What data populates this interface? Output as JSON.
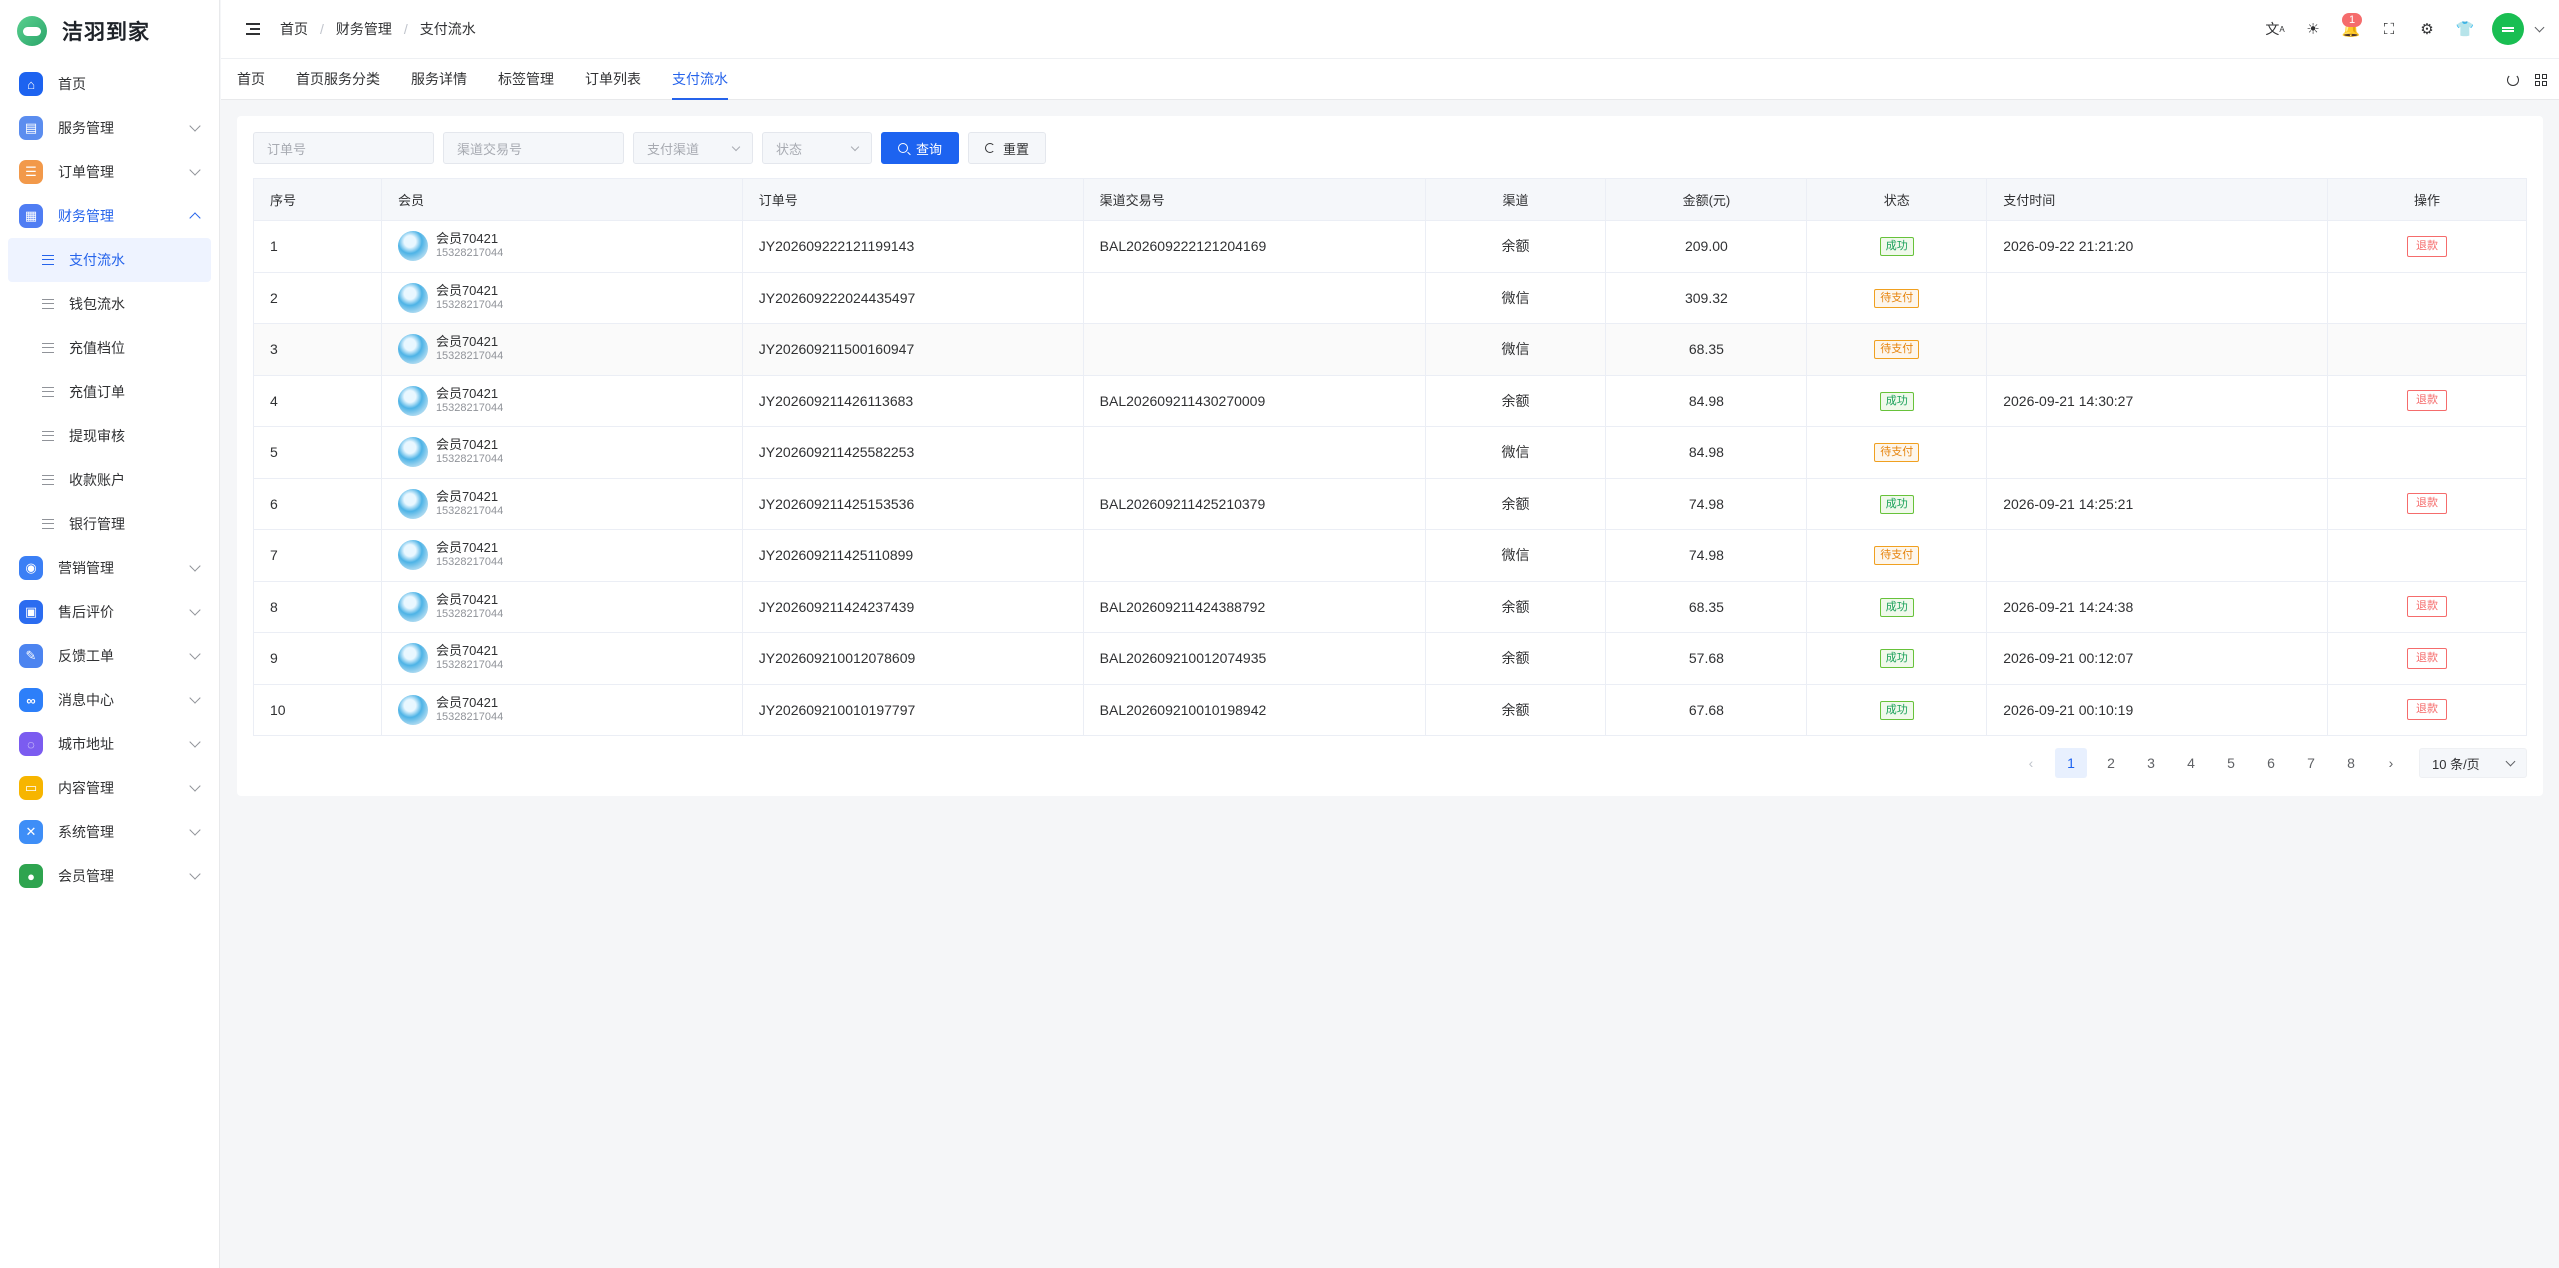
{
  "app": {
    "name": "洁羽到家"
  },
  "sidebar": {
    "items": [
      {
        "label": "首页",
        "icon": "home-icon",
        "color": "#1d63f0",
        "glyph": "⌂",
        "expandable": false
      },
      {
        "label": "服务管理",
        "icon": "clipboard-icon",
        "color": "#5b8def",
        "glyph": "▤",
        "expandable": true
      },
      {
        "label": "订单管理",
        "icon": "order-list-icon",
        "color": "#f2994a",
        "glyph": "☰",
        "expandable": true
      },
      {
        "label": "财务管理",
        "icon": "finance-icon",
        "color": "#4f7df3",
        "glyph": "▦",
        "expandable": true,
        "open": true
      }
    ],
    "finance_sub": [
      {
        "label": "支付流水",
        "active": true
      },
      {
        "label": "钱包流水"
      },
      {
        "label": "充值档位"
      },
      {
        "label": "充值订单"
      },
      {
        "label": "提现审核"
      },
      {
        "label": "收款账户"
      },
      {
        "label": "银行管理"
      }
    ],
    "items_after": [
      {
        "label": "营销管理",
        "icon": "marketing-icon",
        "color": "#3b7ff5",
        "glyph": "◉"
      },
      {
        "label": "售后评价",
        "icon": "apps-icon",
        "color": "#2b6cf0",
        "glyph": "▣"
      },
      {
        "label": "反馈工单",
        "icon": "feedback-icon",
        "color": "#4c84f0",
        "glyph": "✎"
      },
      {
        "label": "消息中心",
        "icon": "link-icon",
        "color": "#2d7ff9",
        "glyph": "∞"
      },
      {
        "label": "城市地址",
        "icon": "planet-icon",
        "color": "#7b5cf0",
        "glyph": "◌"
      },
      {
        "label": "内容管理",
        "icon": "folder-icon",
        "color": "#f7b500",
        "glyph": "▭"
      },
      {
        "label": "系统管理",
        "icon": "tools-icon",
        "color": "#3e8ef7",
        "glyph": "✕"
      },
      {
        "label": "会员管理",
        "icon": "user-icon",
        "color": "#2ea44f",
        "glyph": "●"
      }
    ]
  },
  "header": {
    "breadcrumb": [
      "首页",
      "财务管理",
      "支付流水"
    ],
    "notification_count": "1"
  },
  "tabs": [
    "首页",
    "首页服务分类",
    "服务详情",
    "标签管理",
    "订单列表",
    "支付流水"
  ],
  "active_tab": 5,
  "filters": {
    "order_no_placeholder": "订单号",
    "channel_txn_placeholder": "渠道交易号",
    "channel_placeholder": "支付渠道",
    "status_placeholder": "状态",
    "search_label": "查询",
    "reset_label": "重置"
  },
  "table": {
    "columns": [
      "序号",
      "会员",
      "订单号",
      "渠道交易号",
      "渠道",
      "金额(元)",
      "状态",
      "支付时间",
      "操作"
    ],
    "refund_label": "退款",
    "rows": [
      {
        "no": "1",
        "member": "会员70421",
        "phone": "15328217044",
        "order": "JY202609222121199143",
        "txn": "BAL202609222121204169",
        "channel": "余额",
        "amount": "209.00",
        "status": "成功",
        "status_type": "success",
        "time": "2026-09-22 21:21:20",
        "refund": true
      },
      {
        "no": "2",
        "member": "会员70421",
        "phone": "15328217044",
        "order": "JY202609222024435497",
        "txn": "",
        "channel": "微信",
        "amount": "309.32",
        "status": "待支付",
        "status_type": "warning",
        "time": "",
        "refund": false
      },
      {
        "no": "3",
        "member": "会员70421",
        "phone": "15328217044",
        "order": "JY202609211500160947",
        "txn": "",
        "channel": "微信",
        "amount": "68.35",
        "status": "待支付",
        "status_type": "warning",
        "time": "",
        "refund": false
      },
      {
        "no": "4",
        "member": "会员70421",
        "phone": "15328217044",
        "order": "JY202609211426113683",
        "txn": "BAL202609211430270009",
        "channel": "余额",
        "amount": "84.98",
        "status": "成功",
        "status_type": "success",
        "time": "2026-09-21 14:30:27",
        "refund": true
      },
      {
        "no": "5",
        "member": "会员70421",
        "phone": "15328217044",
        "order": "JY202609211425582253",
        "txn": "",
        "channel": "微信",
        "amount": "84.98",
        "status": "待支付",
        "status_type": "warning",
        "time": "",
        "refund": false
      },
      {
        "no": "6",
        "member": "会员70421",
        "phone": "15328217044",
        "order": "JY202609211425153536",
        "txn": "BAL202609211425210379",
        "channel": "余额",
        "amount": "74.98",
        "status": "成功",
        "status_type": "success",
        "time": "2026-09-21 14:25:21",
        "refund": true
      },
      {
        "no": "7",
        "member": "会员70421",
        "phone": "15328217044",
        "order": "JY202609211425110899",
        "txn": "",
        "channel": "微信",
        "amount": "74.98",
        "status": "待支付",
        "status_type": "warning",
        "time": "",
        "refund": false
      },
      {
        "no": "8",
        "member": "会员70421",
        "phone": "15328217044",
        "order": "JY202609211424237439",
        "txn": "BAL202609211424388792",
        "channel": "余额",
        "amount": "68.35",
        "status": "成功",
        "status_type": "success",
        "time": "2026-09-21 14:24:38",
        "refund": true
      },
      {
        "no": "9",
        "member": "会员70421",
        "phone": "15328217044",
        "order": "JY202609210012078609",
        "txn": "BAL202609210012074935",
        "channel": "余额",
        "amount": "57.68",
        "status": "成功",
        "status_type": "success",
        "time": "2026-09-21 00:12:07",
        "refund": true
      },
      {
        "no": "10",
        "member": "会员70421",
        "phone": "15328217044",
        "order": "JY202609210010197797",
        "txn": "BAL202609210010198942",
        "channel": "余额",
        "amount": "67.68",
        "status": "成功",
        "status_type": "success",
        "time": "2026-09-21 00:10:19",
        "refund": true
      }
    ]
  },
  "pagination": {
    "prev": "‹",
    "next": "›",
    "pages": [
      "1",
      "2",
      "3",
      "4",
      "5",
      "6",
      "7",
      "8"
    ],
    "current": "1",
    "page_size": "10 条/页"
  },
  "colors": {
    "primary": "#1d63f0",
    "success": "#18a058",
    "warning": "#e6840d",
    "danger": "#f56c6c"
  }
}
